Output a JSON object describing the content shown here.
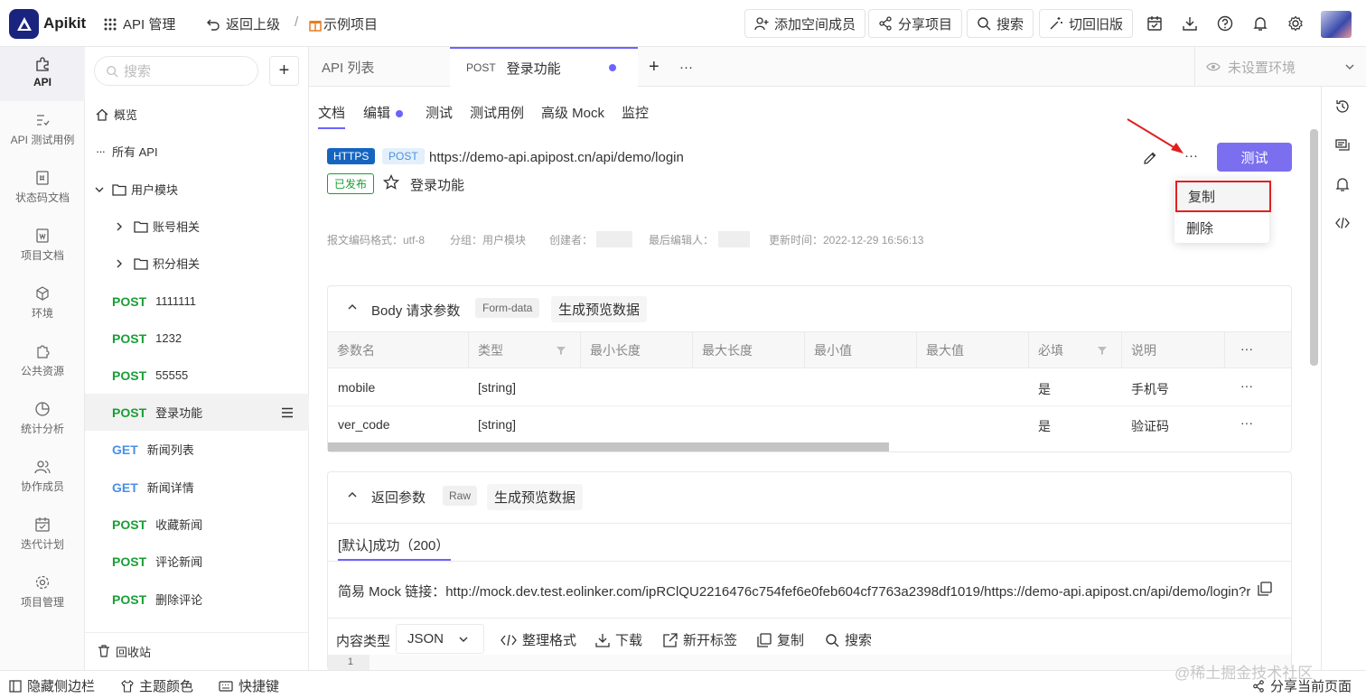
{
  "app": {
    "name": "Apikit"
  },
  "topbar": {
    "api_manage": "API 管理",
    "back": "返回上级",
    "separator": "/",
    "project": "示例项目",
    "add_member": "添加空间成员",
    "share_project": "分享项目",
    "search": "搜索",
    "switch_old": "切回旧版"
  },
  "rail": [
    {
      "label": "API"
    },
    {
      "label": "API 测试用例"
    },
    {
      "label": "状态码文档"
    },
    {
      "label": "项目文档"
    },
    {
      "label": "环境"
    },
    {
      "label": "公共资源"
    },
    {
      "label": "统计分析"
    },
    {
      "label": "协作成员"
    },
    {
      "label": "迭代计划"
    },
    {
      "label": "项目管理"
    }
  ],
  "tree": {
    "search_placeholder": "搜索",
    "overview": "概览",
    "all_api": "所有 API",
    "group": "用户模块",
    "sub_groups": [
      "账号相关",
      "积分相关"
    ],
    "apis": [
      {
        "method": "POST",
        "name": "1111111"
      },
      {
        "method": "POST",
        "name": "1232"
      },
      {
        "method": "POST",
        "name": "55555"
      },
      {
        "method": "POST",
        "name": "登录功能"
      },
      {
        "method": "GET",
        "name": "新闻列表"
      },
      {
        "method": "GET",
        "name": "新闻详情"
      },
      {
        "method": "POST",
        "name": "收藏新闻"
      },
      {
        "method": "POST",
        "name": "评论新闻"
      },
      {
        "method": "POST",
        "name": "删除评论"
      }
    ],
    "recycle": "回收站"
  },
  "tabs": {
    "api_list": "API 列表",
    "active_method": "POST",
    "active_name": "登录功能",
    "add": "+",
    "more": "···",
    "env": "未设置环境"
  },
  "subtabs": [
    "文档",
    "编辑",
    "测试",
    "测试用例",
    "高级 Mock",
    "监控"
  ],
  "api": {
    "protocol": "HTTPS",
    "method": "POST",
    "url": "https://demo-api.apipost.cn/api/demo/login",
    "status": "已发布",
    "name": "登录功能",
    "test_button": "测试",
    "meta": {
      "encoding": "报文编码格式：utf-8",
      "group": "分组：用户模块",
      "creator": "创建者：",
      "editor": "最后编辑人：",
      "updated": "更新时间：2022-12-29 16:56:13"
    }
  },
  "dropdown": {
    "copy": "复制",
    "delete": "删除"
  },
  "body_params": {
    "title": "Body 请求参数",
    "format": "Form-data",
    "gen_preview": "生成预览数据",
    "columns": [
      "参数名",
      "类型",
      "最小长度",
      "最大长度",
      "最小值",
      "最大值",
      "必填",
      "说明"
    ],
    "rows": [
      {
        "name": "mobile",
        "type": "[string]",
        "required": "是",
        "desc": "手机号"
      },
      {
        "name": "ver_code",
        "type": "[string]",
        "required": "是",
        "desc": "验证码"
      }
    ]
  },
  "response": {
    "title": "返回参数",
    "format": "Raw",
    "gen_preview": "生成预览数据",
    "tab": "[默认]成功（200）",
    "mock_label": "简易 Mock 链接：",
    "mock_url": "http://mock.dev.test.eolinker.com/ipRClQU2216476c754fef6e0feb604cf7763a2398df1019/https://demo-api.apipost.cn/api/demo/login?res...",
    "content_type_label": "内容类型",
    "content_type": "JSON",
    "tools": [
      "整理格式",
      "下载",
      "新开标签",
      "复制",
      "搜索"
    ],
    "line_no": "1"
  },
  "statusbar": {
    "hide_sidebar": "隐藏侧边栏",
    "theme": "主题颜色",
    "shortcuts": "快捷键",
    "share_page": "分享当前页面",
    "watermark": "@稀土掘金技术社区"
  },
  "colors": {
    "accent": "#6c63ff",
    "post": "#1a9e36",
    "get": "#4a90e2",
    "highlight": "#e02020"
  }
}
